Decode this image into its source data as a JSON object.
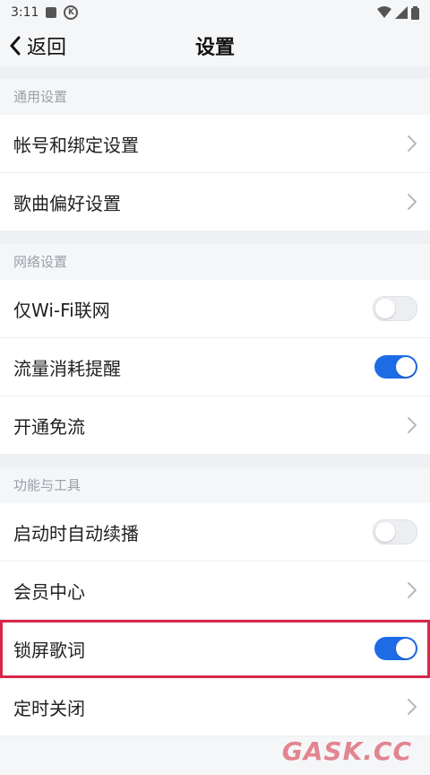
{
  "status_bar": {
    "time": "3:11"
  },
  "header": {
    "back_label": "返回",
    "title": "设置"
  },
  "sections": [
    {
      "title": "通用设置",
      "rows": [
        {
          "label": "帐号和绑定设置",
          "type": "chevron"
        },
        {
          "label": "歌曲偏好设置",
          "type": "chevron"
        }
      ]
    },
    {
      "title": "网络设置",
      "rows": [
        {
          "label": "仅Wi-Fi联网",
          "type": "toggle",
          "on": false
        },
        {
          "label": "流量消耗提醒",
          "type": "toggle",
          "on": true
        },
        {
          "label": "开通免流",
          "type": "chevron"
        }
      ]
    },
    {
      "title": "功能与工具",
      "rows": [
        {
          "label": "启动时自动续播",
          "type": "toggle",
          "on": false
        },
        {
          "label": "会员中心",
          "type": "chevron"
        },
        {
          "label": "锁屏歌词",
          "type": "toggle",
          "on": true,
          "highlighted": true
        },
        {
          "label": "定时关闭",
          "type": "chevron"
        }
      ]
    }
  ],
  "watermark": "GASK.CC",
  "colors": {
    "accent": "#1e6be6",
    "highlight": "#d8264a"
  }
}
